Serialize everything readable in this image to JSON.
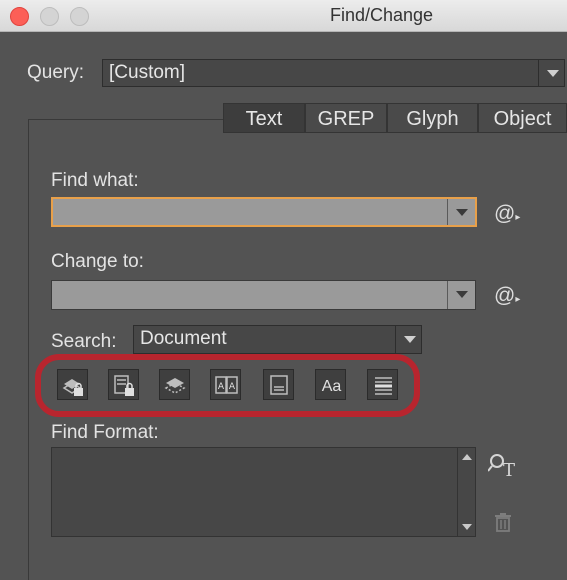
{
  "window": {
    "title": "Find/Change"
  },
  "query": {
    "label": "Query:",
    "value": "[Custom]"
  },
  "tabs": [
    {
      "label": "Text",
      "active": true
    },
    {
      "label": "GREP",
      "active": false
    },
    {
      "label": "Glyph",
      "active": false
    },
    {
      "label": "Object",
      "active": false
    }
  ],
  "find": {
    "label": "Find what:",
    "value": "",
    "special_char_symbol": "@"
  },
  "change": {
    "label": "Change to:",
    "value": "",
    "special_char_symbol": "@"
  },
  "search": {
    "label": "Search:",
    "value": "Document"
  },
  "options_toolbar": {
    "highlight_color": "#b8252e",
    "buttons": [
      "include-locked-layers-icon",
      "include-locked-stories-icon",
      "include-hidden-layers-icon",
      "include-master-pages-icon",
      "include-footnotes-icon",
      "case-sensitive-icon",
      "whole-word-icon"
    ],
    "case_sensitive_text": "Aa"
  },
  "find_format": {
    "label": "Find Format:"
  }
}
